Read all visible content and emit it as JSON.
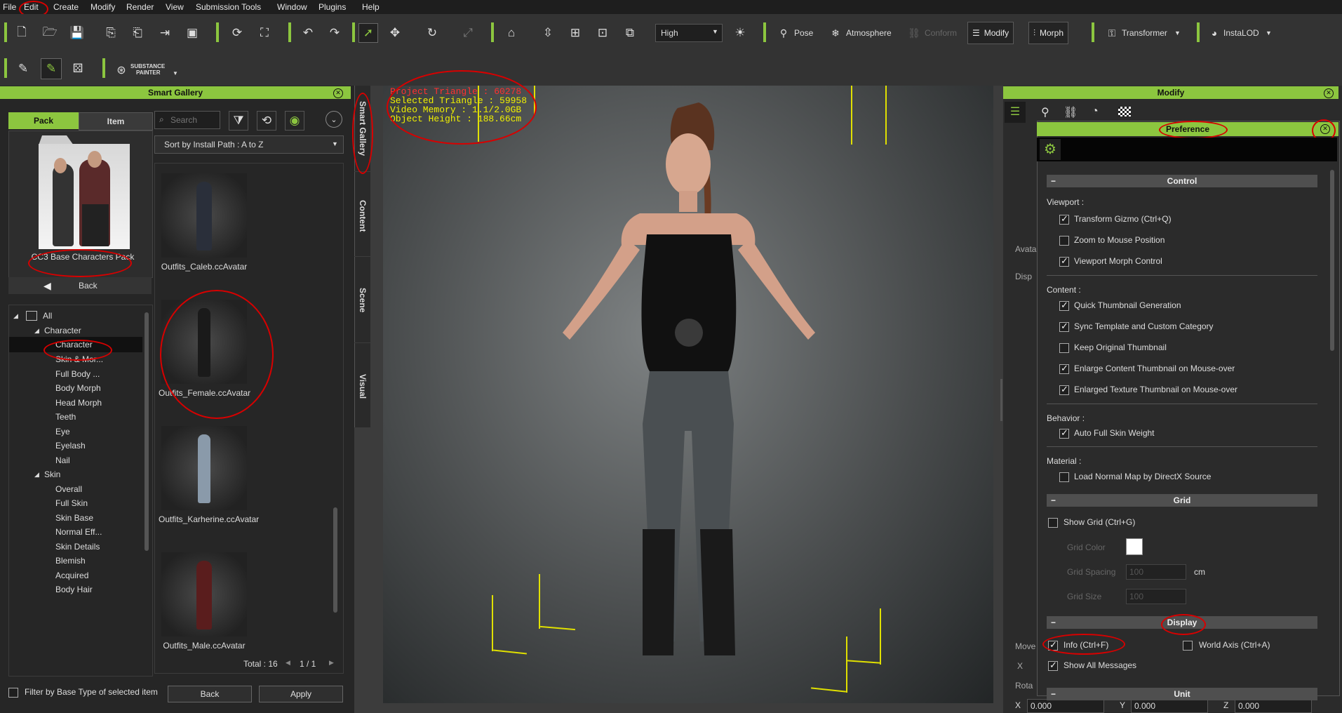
{
  "menu": [
    "File",
    "Edit",
    "Create",
    "Modify",
    "Render",
    "View",
    "Submission Tools",
    "Window",
    "Plugins",
    "Help"
  ],
  "toolbar": {
    "quality": "High",
    "pose": "Pose",
    "atmosphere": "Atmosphere",
    "conform": "Conform",
    "modify": "Modify",
    "morph": "Morph",
    "transformer": "Transformer",
    "instalod": "InstaLOD",
    "substance_line1": "SUBSTANCE",
    "substance_line2": "PAINTER"
  },
  "gallery": {
    "title": "Smart Gallery",
    "tab_pack": "Pack",
    "tab_item": "Item",
    "search_placeholder": "Search",
    "sort": "Sort by Install Path : A to Z",
    "pack_name": "CC3 Base Characters Pack",
    "back": "Back",
    "tree": [
      "All",
      "Character",
      "Character",
      "Skin & Mor...",
      "Full Body ...",
      "Body Morph",
      "Head Morph",
      "Teeth",
      "Eye",
      "Eyelash",
      "Nail",
      "Skin",
      "Overall",
      "Full Skin",
      "Skin Base",
      "Normal Eff...",
      "Skin Details",
      "Blemish",
      "Acquired",
      "Body Hair"
    ],
    "items": [
      "Outfits_Caleb.ccAvatar",
      "Outfits_Female.ccAvatar",
      "Outfits_Karherine.ccAvatar",
      "Outfits_Male.ccAvatar"
    ],
    "total": "Total : 16",
    "page": "1 / 1",
    "filter_label": "Filter by Base Type of selected item",
    "btn_back": "Back",
    "btn_apply": "Apply"
  },
  "side_tabs": [
    "Smart Gallery",
    "Content",
    "Scene",
    "Visual"
  ],
  "viewport": {
    "info": [
      "Project Triangle : 60278",
      "Selected Triangle : 59958",
      "Video Memory : 1.1/2.0GB",
      "Object Height : 188.66cm"
    ]
  },
  "modify": {
    "title": "Modify",
    "avatar_label": "Avata",
    "disp_label": "Disp",
    "move_label": "Move",
    "rota_label": "Rota",
    "x_label": "X",
    "y_label": "Y",
    "z_label": "Z",
    "x_val": "0.000",
    "y_val": "0.000",
    "z_val": "0.000"
  },
  "preference": {
    "title": "Preference",
    "control": "Control",
    "viewport_label": "Viewport :",
    "viewport_opts": [
      {
        "label": "Transform Gizmo (Ctrl+Q)",
        "checked": true
      },
      {
        "label": "Zoom to Mouse Position",
        "checked": false
      },
      {
        "label": "Viewport Morph Control",
        "checked": true
      }
    ],
    "content_label": "Content :",
    "content_opts": [
      {
        "label": "Quick Thumbnail Generation",
        "checked": true
      },
      {
        "label": "Sync Template and Custom Category",
        "checked": true
      },
      {
        "label": "Keep Original Thumbnail",
        "checked": false
      },
      {
        "label": "Enlarge Content Thumbnail on Mouse-over",
        "checked": true
      },
      {
        "label": "Enlarged Texture Thumbnail on Mouse-over",
        "checked": true
      }
    ],
    "behavior_label": "Behavior :",
    "behavior_opt": "Auto Full Skin Weight",
    "material_label": "Material :",
    "material_opt": "Load Normal Map by DirectX Source",
    "grid": "Grid",
    "show_grid": "Show Grid (Ctrl+G)",
    "grid_color": "Grid Color",
    "grid_spacing": "Grid Spacing",
    "grid_spacing_val": "100",
    "grid_spacing_unit": "cm",
    "grid_size": "Grid Size",
    "grid_size_val": "100",
    "display": "Display",
    "info": "Info (Ctrl+F)",
    "world_axis": "World Axis (Ctrl+A)",
    "show_all": "Show All Messages",
    "unit": "Unit"
  },
  "colors": {
    "accent": "#8cc63f",
    "annotation": "#d80000",
    "info_highlight": "#ff3030",
    "info_text": "#f0f000"
  }
}
